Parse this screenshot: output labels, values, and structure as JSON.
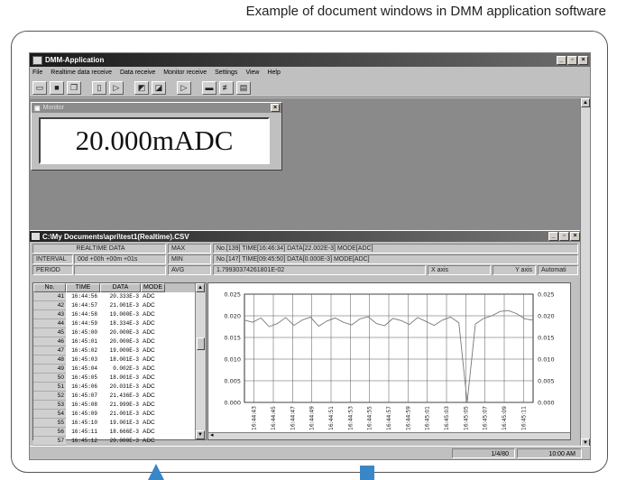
{
  "caption": "Example of document windows in DMM application software",
  "app": {
    "title": "DMM-Application",
    "menu": [
      "File",
      "Realtime data receive",
      "Data receive",
      "Monitor receive",
      "Settings",
      "View",
      "Help"
    ]
  },
  "monitor": {
    "title": "Monitor",
    "reading": "20.000mADC"
  },
  "datawin": {
    "title": "C:\\My Documents\\apri\\test1(Realtime).CSV",
    "realtime_label": "REALTIME DATA",
    "interval_label": "INTERVAL",
    "interval_value": "00d +00h +00m +01s",
    "period_label": "PERIOD",
    "max_label": "MAX",
    "max_value": "No.[139]  TIME[16:46:34]  DATA[22.002E-3]  MODE[ADC]",
    "min_label": "MIN",
    "min_value": "No.[147]  TIME[09:45:50]  DATA[0.000E-3]  MODE[ADC]",
    "avg_label": "AVG",
    "avg_value": "1.79930374261801E-02",
    "xaxis_label": "X axis",
    "yaxis_label": "Y axis",
    "automatic_label": "Automati"
  },
  "table": {
    "headers": [
      "No.",
      "TIME",
      "DATA",
      "MODE"
    ],
    "rows": [
      {
        "no": "41",
        "time": "16:44:56",
        "data": "20.333E-3",
        "mode": "ADC"
      },
      {
        "no": "42",
        "time": "16:44:57",
        "data": "21.001E-3",
        "mode": "ADC"
      },
      {
        "no": "43",
        "time": "16:44:58",
        "data": "19.000E-3",
        "mode": "ADC"
      },
      {
        "no": "44",
        "time": "16:44:59",
        "data": "18.334E-3",
        "mode": "ADC"
      },
      {
        "no": "45",
        "time": "16:45:00",
        "data": "20.000E-3",
        "mode": "ADC"
      },
      {
        "no": "46",
        "time": "16:45:01",
        "data": "20.000E-3",
        "mode": "ADC"
      },
      {
        "no": "47",
        "time": "16:45:02",
        "data": "19.000E-3",
        "mode": "ADC"
      },
      {
        "no": "48",
        "time": "16:45:03",
        "data": "18.001E-3",
        "mode": "ADC"
      },
      {
        "no": "49",
        "time": "16:45:04",
        "data": "0.002E-3",
        "mode": "ADC"
      },
      {
        "no": "50",
        "time": "16:45:05",
        "data": "18.001E-3",
        "mode": "ADC"
      },
      {
        "no": "51",
        "time": "16:45:06",
        "data": "20.031E-3",
        "mode": "ADC"
      },
      {
        "no": "52",
        "time": "16:45:07",
        "data": "21.436E-3",
        "mode": "ADC"
      },
      {
        "no": "53",
        "time": "16:45:08",
        "data": "21.999E-3",
        "mode": "ADC"
      },
      {
        "no": "54",
        "time": "16:45:09",
        "data": "21.001E-3",
        "mode": "ADC"
      },
      {
        "no": "55",
        "time": "16:45:10",
        "data": "19.001E-3",
        "mode": "ADC"
      },
      {
        "no": "56",
        "time": "16:45:11",
        "data": "18.666E-3",
        "mode": "ADC"
      },
      {
        "no": "57",
        "time": "16:45:12",
        "data": "20.000E-3",
        "mode": "ADC"
      }
    ]
  },
  "chart_data": {
    "type": "line",
    "x": [
      "16:44:43",
      "16:44:45",
      "16:44:47",
      "16:44:49",
      "16:44:51",
      "16:44:53",
      "16:44:55",
      "16:44:57",
      "16:44:59",
      "16:45:01",
      "16:45:03",
      "16:45:05",
      "16:45:07",
      "16:45:09",
      "16:45:11"
    ],
    "series": [
      {
        "values": [
          0.019,
          0.0185,
          0.0195,
          0.0175,
          0.0182,
          0.0196,
          0.0178,
          0.019,
          0.0197,
          0.0176,
          0.0188,
          0.0195,
          0.0185,
          0.0179,
          0.0193,
          0.0198,
          0.0182,
          0.0177,
          0.0194,
          0.0189,
          0.018,
          0.0196,
          0.0187,
          0.0178,
          0.019,
          0.0197,
          0.0184,
          0.0,
          0.0181,
          0.0194,
          0.02,
          0.021,
          0.0212,
          0.0205,
          0.0193,
          0.019
        ]
      }
    ],
    "y_ticks": [
      "0.025",
      "0.020",
      "0.015",
      "0.010",
      "0.005",
      "0.000"
    ],
    "ylim": [
      0,
      0.025
    ],
    "grid": true
  },
  "status": {
    "page": "1/4/80",
    "time": "10:00 AM"
  }
}
